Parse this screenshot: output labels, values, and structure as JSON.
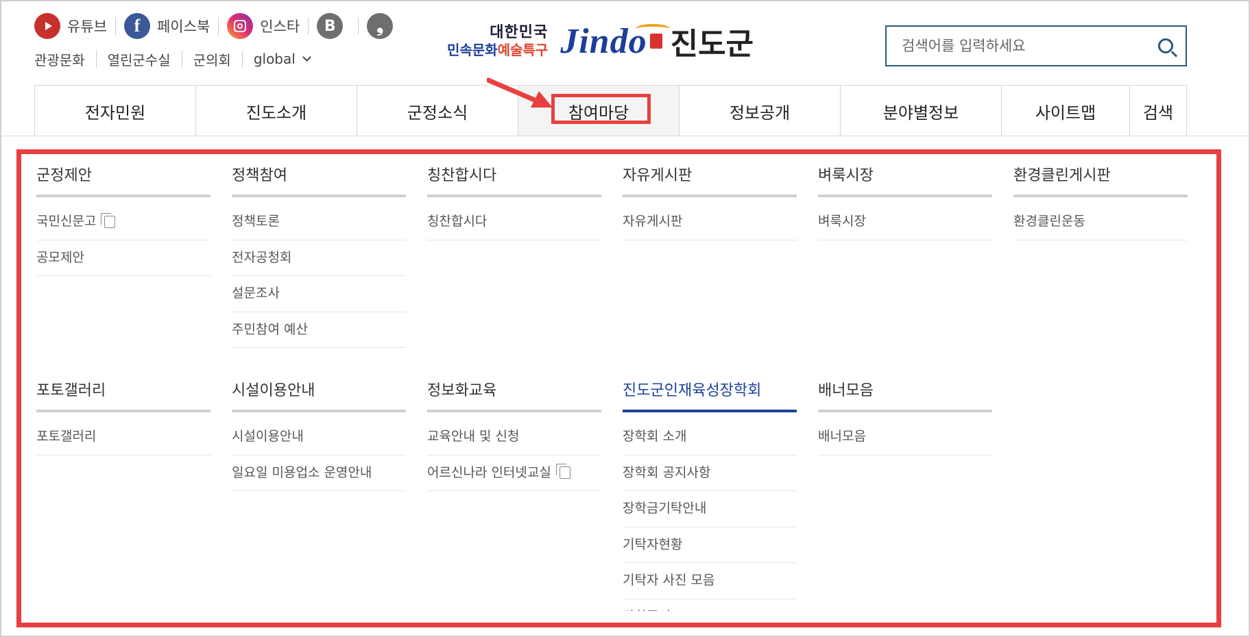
{
  "social": [
    {
      "label": "유튜브",
      "icon": "youtube-icon"
    },
    {
      "label": "페이스북",
      "icon": "facebook-icon"
    },
    {
      "label": "인스타",
      "icon": "instagram-icon"
    },
    {
      "label": "",
      "icon": "blog-icon"
    },
    {
      "label": "",
      "icon": "kakao-icon"
    }
  ],
  "util_links": [
    "관광문화",
    "열린군수실",
    "군의회",
    "global"
  ],
  "logo": {
    "slogan_top": "대한민국",
    "slogan_bottom_a": "민속문화",
    "slogan_bottom_b": "예술특구",
    "brand": "Jindo",
    "name": "진도군"
  },
  "search": {
    "placeholder": "검색어를 입력하세요"
  },
  "gnb": [
    "전자민원",
    "진도소개",
    "군정소식",
    "참여마당",
    "정보공개",
    "분야별정보",
    "사이트맵",
    "검색"
  ],
  "gnb_active": "참여마당",
  "colors": {
    "highlight": "#e84040",
    "brand_blue": "#1d3f9a"
  },
  "mega_menu": {
    "row1": [
      {
        "title": "군정제안",
        "items": [
          "국민신문고",
          "공모제안"
        ]
      },
      {
        "title": "정책참여",
        "items": [
          "정책토론",
          "전자공청회",
          "설문조사",
          "주민참여 예산"
        ]
      },
      {
        "title": "칭찬합시다",
        "items": [
          "칭찬합시다"
        ]
      },
      {
        "title": "자유게시판",
        "items": [
          "자유게시판"
        ]
      },
      {
        "title": "벼룩시장",
        "items": [
          "벼룩시장"
        ]
      },
      {
        "title": "환경클린게시판",
        "items": [
          "환경클린운동"
        ]
      }
    ],
    "row2": [
      {
        "title": "포토갤러리",
        "items": [
          "포토갤러리"
        ]
      },
      {
        "title": "시설이용안내",
        "items": [
          "시설이용안내",
          "일요일 미용업소 운영안내"
        ]
      },
      {
        "title": "정보화교육",
        "items": [
          "교육안내 및 신청",
          "어르신나라 인터넷교실"
        ]
      },
      {
        "title": "진도군인재육성장학회",
        "items": [
          "장학회 소개",
          "장학회 공지사항",
          "장학금기탁안내",
          "기탁자현황",
          "기탁자 사진 모음",
          "장학증서"
        ]
      },
      {
        "title": "배너모음",
        "items": [
          "배너모음"
        ]
      }
    ]
  }
}
